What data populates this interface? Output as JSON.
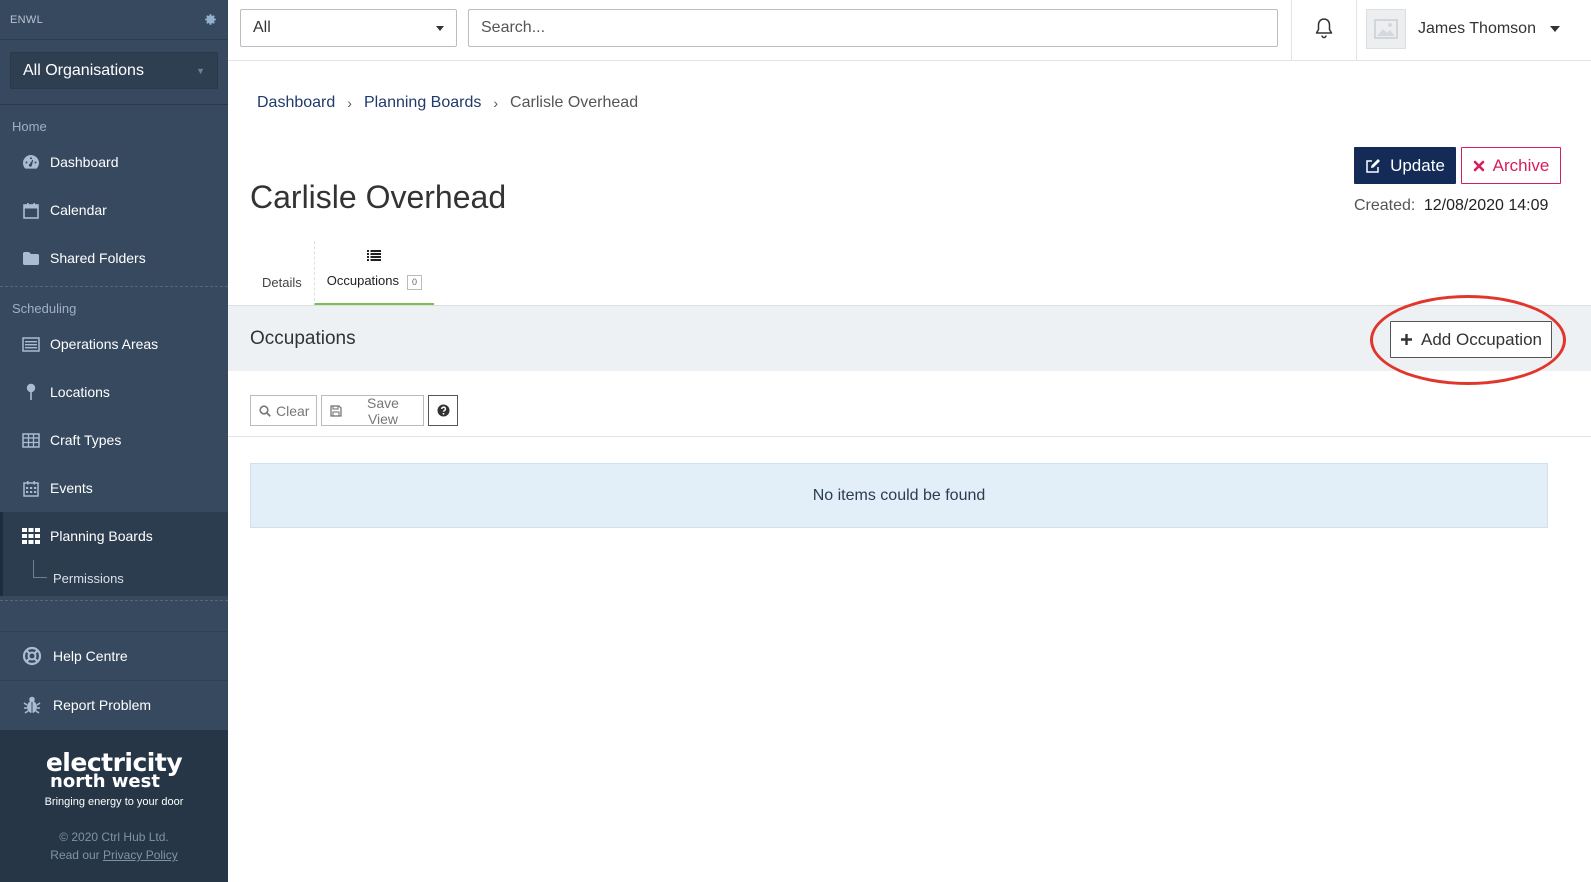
{
  "sidebar": {
    "brand": "ENWL",
    "org_select": "All Organisations",
    "sections": {
      "home": "Home",
      "scheduling": "Scheduling"
    },
    "home_items": [
      {
        "label": "Dashboard",
        "icon": "dashboard-icon"
      },
      {
        "label": "Calendar",
        "icon": "calendar-icon"
      },
      {
        "label": "Shared Folders",
        "icon": "folder-icon"
      }
    ],
    "scheduling_items": [
      {
        "label": "Operations Areas",
        "icon": "list-icon"
      },
      {
        "label": "Locations",
        "icon": "pin-icon"
      },
      {
        "label": "Craft Types",
        "icon": "table-icon"
      },
      {
        "label": "Events",
        "icon": "calendar-grid-icon"
      },
      {
        "label": "Planning Boards",
        "icon": "grid-icon"
      }
    ],
    "sub_item": "Permissions",
    "help_centre": "Help Centre",
    "report_problem": "Report Problem",
    "footer": {
      "logo_line1": "electricity",
      "logo_line2": "north west",
      "tagline": "Bringing energy to your door",
      "copyright": "© 2020 Ctrl Hub Ltd.",
      "privacy_prefix": "Read our",
      "privacy_link": "Privacy Policy"
    }
  },
  "topbar": {
    "scope_select": "All",
    "search_placeholder": "Search...",
    "user_name": "James Thomson"
  },
  "breadcrumb": {
    "items": [
      "Dashboard",
      "Planning Boards"
    ],
    "current": "Carlisle Overhead"
  },
  "page": {
    "title": "Carlisle Overhead",
    "update_label": "Update",
    "archive_label": "Archive",
    "created_label": "Created:",
    "created_value": "12/08/2020 14:09"
  },
  "tabs": [
    {
      "label": "Details",
      "active": false
    },
    {
      "label": "Occupations",
      "count": "0",
      "active": true
    }
  ],
  "occupations": {
    "title": "Occupations",
    "add_label": "Add Occupation",
    "clear_label": "Clear",
    "save_view_label": "Save View",
    "empty_message": "No items could be found"
  },
  "colors": {
    "sidebar_bg": "#36495e",
    "primary": "#142a57",
    "danger": "#d61f5a",
    "tab_active": "#79c24a",
    "annotation_ring": "#e0362b"
  }
}
